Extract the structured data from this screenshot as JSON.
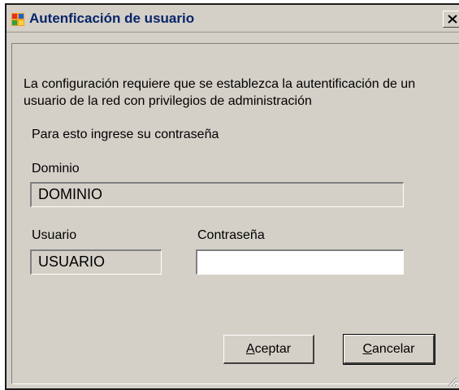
{
  "window": {
    "title": "Autenficación de usuario",
    "title_color": "#08246b",
    "face_color": "#d4d0c8",
    "icon": "app-window-icon",
    "close_icon": "close-icon"
  },
  "form": {
    "description": "La configuración requiere que se establezca la autentificación de un usuario de la red con privilegios de administración",
    "instruction": "Para esto ingrese su contraseña",
    "domain_label": "Dominio",
    "domain_value": "DOMINIO",
    "user_label": "Usuario",
    "user_value": "USUARIO",
    "password_label": "Contraseña",
    "password_value": ""
  },
  "buttons": {
    "accept": {
      "underlined": "A",
      "rest": "ceptar"
    },
    "cancel": {
      "underlined": "C",
      "rest": "ancelar"
    }
  }
}
